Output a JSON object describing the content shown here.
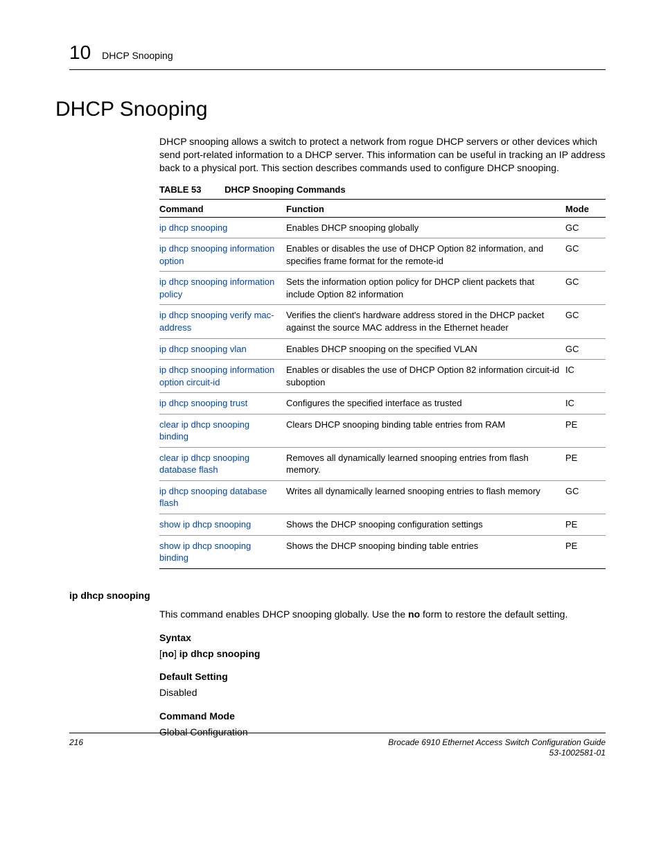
{
  "header": {
    "chapter_number": "10",
    "section": "DHCP Snooping"
  },
  "title": "DHCP Snooping",
  "intro": "DHCP snooping allows a switch to protect a network from rogue DHCP servers or other devices which send port-related information to a DHCP server. This information can be useful in tracking an IP address back to a physical port. This section describes commands used to configure DHCP snooping.",
  "table": {
    "label": "TABLE 53",
    "caption": "DHCP Snooping Commands",
    "headers": {
      "command": "Command",
      "function": "Function",
      "mode": "Mode"
    },
    "rows": [
      {
        "command": "ip dhcp snooping",
        "function": "Enables DHCP snooping globally",
        "mode": "GC"
      },
      {
        "command": "ip dhcp snooping information option",
        "function": "Enables or disables the use of DHCP Option 82 information, and specifies frame format for the remote-id",
        "mode": "GC"
      },
      {
        "command": "ip dhcp snooping information policy",
        "function": "Sets the information option policy for DHCP client packets that include Option 82 information",
        "mode": "GC"
      },
      {
        "command": "ip dhcp snooping verify mac-address",
        "function": "Verifies the client's hardware address stored in the DHCP packet against the source MAC address in the Ethernet header",
        "mode": "GC"
      },
      {
        "command": "ip dhcp snooping vlan",
        "function": "Enables DHCP snooping on the specified VLAN",
        "mode": "GC"
      },
      {
        "command": "ip dhcp snooping information option circuit-id",
        "function": "Enables or disables the use of DHCP Option 82 information circuit-id suboption",
        "mode": "IC"
      },
      {
        "command": "ip dhcp snooping trust",
        "function": "Configures the specified interface as trusted",
        "mode": "IC"
      },
      {
        "command": "clear ip dhcp snooping binding",
        "function": "Clears DHCP snooping binding table entries from RAM",
        "mode": "PE"
      },
      {
        "command": "clear ip dhcp snooping database flash",
        "function": "Removes all dynamically learned snooping entries from flash memory.",
        "mode": "PE"
      },
      {
        "command": "ip dhcp snooping database flash",
        "function": "Writes all dynamically learned snooping entries to flash memory",
        "mode": "GC"
      },
      {
        "command": "show ip dhcp snooping",
        "function": "Shows the DHCP snooping configuration settings",
        "mode": "PE"
      },
      {
        "command": "show ip dhcp snooping binding",
        "function": "Shows the DHCP snooping binding table entries",
        "mode": "PE"
      }
    ]
  },
  "detail": {
    "heading": "ip dhcp snooping",
    "description_pre": "This command enables DHCP snooping globally. Use the ",
    "description_bold": "no",
    "description_post": " form to restore the default setting.",
    "syntax_label": "Syntax",
    "syntax_open": "[",
    "syntax_no": "no",
    "syntax_close": "] ",
    "syntax_cmd": "ip dhcp snooping",
    "default_label": "Default Setting",
    "default_value": "Disabled",
    "mode_label": "Command Mode",
    "mode_value": "Global Configuration"
  },
  "footer": {
    "page": "216",
    "doc_title": "Brocade 6910 Ethernet Access Switch Configuration Guide",
    "doc_num": "53-1002581-01"
  }
}
